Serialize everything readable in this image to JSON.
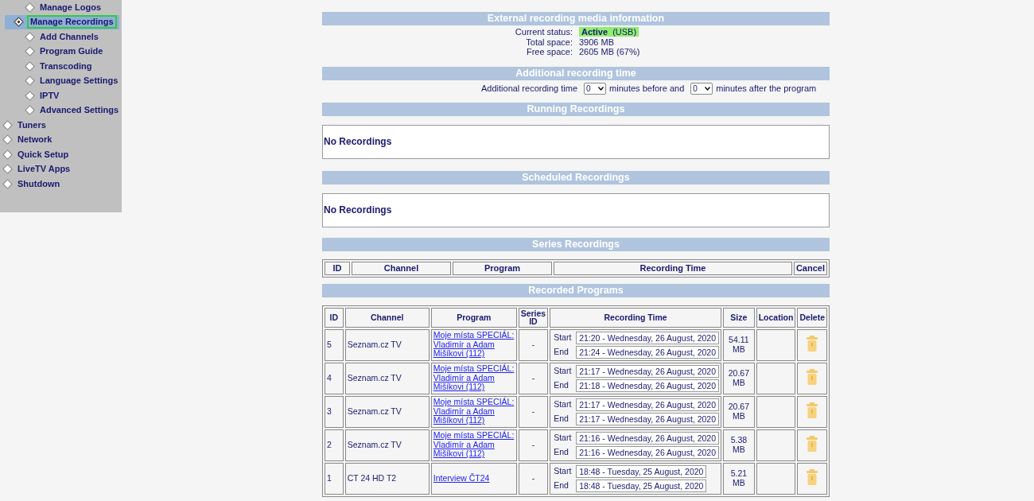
{
  "sidebar": {
    "sub_items": [
      {
        "label": "Manage Logos",
        "selected": false
      },
      {
        "label": "Manage Recordings",
        "selected": true
      },
      {
        "label": "Add Channels",
        "selected": false
      },
      {
        "label": "Program Guide",
        "selected": false
      },
      {
        "label": "Transcoding",
        "selected": false
      },
      {
        "label": "Language Settings",
        "selected": false
      },
      {
        "label": "IPTV",
        "selected": false
      },
      {
        "label": "Advanced Settings",
        "selected": false
      }
    ],
    "items": [
      {
        "label": "Tuners",
        "selected": false
      },
      {
        "label": "Network",
        "selected": false
      },
      {
        "label": "Quick Setup",
        "selected": false
      },
      {
        "label": "LiveTV Apps",
        "selected": false
      },
      {
        "label": "Shutdown",
        "selected": false
      }
    ]
  },
  "media_info": {
    "title": "External recording media information",
    "fields": [
      {
        "label": "Current status:",
        "value": "Active",
        "detail": "(USB)",
        "active": true
      },
      {
        "label": "Total space:",
        "value": "3906 MB"
      },
      {
        "label": "Free space:",
        "value": "2605 MB (67%)"
      }
    ]
  },
  "additional_time": {
    "title": "Additional recording time",
    "label": "Additional recording time",
    "before_value": "0",
    "before_text": "minutes before and",
    "after_value": "0",
    "after_text": "minutes after the program"
  },
  "running": {
    "title": "Running Recordings",
    "message": "No Recordings"
  },
  "scheduled": {
    "title": "Scheduled Recordings",
    "message": "No Recordings"
  },
  "series": {
    "title": "Series Recordings",
    "columns": [
      "ID",
      "Channel",
      "Program",
      "Recording Time",
      "Cancel"
    ]
  },
  "recorded": {
    "title": "Recorded Programs",
    "columns": [
      "ID",
      "Channel",
      "Program",
      "Series ID",
      "Recording Time",
      "Size",
      "Location",
      "Delete"
    ],
    "rows": [
      {
        "id": "5",
        "channel": "Seznam.cz TV",
        "program": "Moje místa SPECIÁL: Vladimír a Adam Mišíkovi (112)",
        "series_id": "-",
        "start_label": "Start",
        "start": "21:20 - Wednesday, 26 August, 2020",
        "end_label": "End",
        "end": "21:24 - Wednesday, 26 August, 2020",
        "size": "54.11 MB"
      },
      {
        "id": "4",
        "channel": "Seznam.cz TV",
        "program": "Moje místa SPECIÁL: Vladimír a Adam Mišíkovi (112)",
        "series_id": "-",
        "start_label": "Start",
        "start": "21:17 - Wednesday, 26 August, 2020",
        "end_label": "End",
        "end": "21:18 - Wednesday, 26 August, 2020",
        "size": "20.67 MB"
      },
      {
        "id": "3",
        "channel": "Seznam.cz TV",
        "program": "Moje místa SPECIÁL: Vladimír a Adam Mišíkovi (112)",
        "series_id": "-",
        "start_label": "Start",
        "start": "21:17 - Wednesday, 26 August, 2020",
        "end_label": "End",
        "end": "21:17 - Wednesday, 26 August, 2020",
        "size": "20.67 MB"
      },
      {
        "id": "2",
        "channel": "Seznam.cz TV",
        "program": "Moje místa SPECIÁL: Vladimír a Adam Mišíkovi (112)",
        "series_id": "-",
        "start_label": "Start",
        "start": "21:16 - Wednesday, 26 August, 2020",
        "end_label": "End",
        "end": "21:16 - Wednesday, 26 August, 2020",
        "size": "5.38 MB"
      },
      {
        "id": "1",
        "channel": "CT 24 HD T2",
        "program": "Interview ČT24",
        "series_id": "-",
        "start_label": "Start",
        "start": "18:48 - Tuesday, 25 August, 2020",
        "end_label": "End",
        "end": "18:48 - Tuesday, 25 August, 2020",
        "size": "5.21 MB"
      }
    ]
  }
}
